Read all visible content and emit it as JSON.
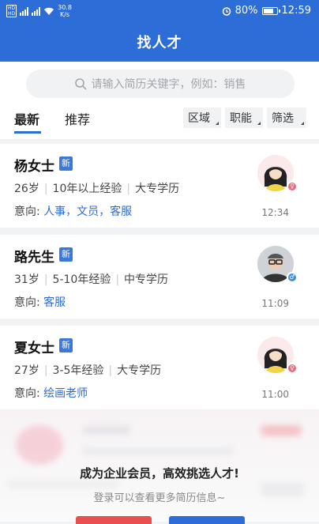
{
  "status": {
    "net_speed": "30.8",
    "net_unit": "K/s",
    "battery": "80%",
    "battery_level": 0.8,
    "time": "12:59"
  },
  "header": {
    "title": "找人才"
  },
  "search": {
    "placeholder": "请输入简历关键字，例如：销售"
  },
  "tabs": [
    {
      "label": "最新"
    },
    {
      "label": "推荐"
    }
  ],
  "filters": [
    {
      "label": "区域"
    },
    {
      "label": "职能"
    },
    {
      "label": "筛选"
    }
  ],
  "candidates": [
    {
      "name": "杨女士",
      "badge": "新",
      "age": "26岁",
      "experience": "10年以上经验",
      "education": "大专学历",
      "intent_label": "意向:",
      "intent": "人事，文员，客服",
      "time": "12:34",
      "gender": "female"
    },
    {
      "name": "路先生",
      "badge": "新",
      "age": "31岁",
      "experience": "5-10年经验",
      "education": "中专学历",
      "intent_label": "意向:",
      "intent": "客服",
      "time": "11:09",
      "gender": "male"
    },
    {
      "name": "夏女士",
      "badge": "新",
      "age": "27岁",
      "experience": "3-5年经验",
      "education": "大专学历",
      "intent_label": "意向:",
      "intent": "绘画老师",
      "time": "11:00",
      "gender": "female"
    }
  ],
  "promo": {
    "headline": "成为企业会员，高效挑选人才!",
    "sub": "登录可以查看更多简历信息~"
  },
  "colors": {
    "brand": "#2d6dd8",
    "badge": "#3c78d8",
    "accent_red": "#e8504f"
  }
}
